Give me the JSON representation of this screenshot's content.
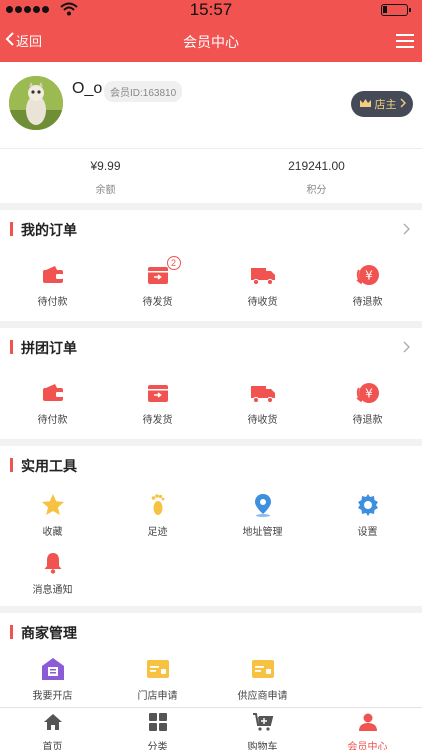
{
  "status_bar": {
    "time": "15:57"
  },
  "nav": {
    "back_label": "返回",
    "title": "会员中心"
  },
  "profile": {
    "username": "O_o",
    "member_id": "会员ID:163810",
    "shop_button": "店主"
  },
  "balance": {
    "left": {
      "value": "¥9.99",
      "label": "余额"
    },
    "right": {
      "value": "219241.00",
      "label": "积分"
    }
  },
  "my_orders": {
    "title": "我的订单",
    "items": [
      {
        "label": "待付款",
        "icon": "wallet-icon"
      },
      {
        "label": "待发货",
        "icon": "ship-box-icon",
        "badge": "2"
      },
      {
        "label": "待收货",
        "icon": "truck-icon"
      },
      {
        "label": "待退款",
        "icon": "refund-icon"
      }
    ]
  },
  "group_orders": {
    "title": "拼团订单",
    "items": [
      {
        "label": "待付款",
        "icon": "wallet-icon"
      },
      {
        "label": "待发货",
        "icon": "ship-box-icon"
      },
      {
        "label": "待收货",
        "icon": "truck-icon"
      },
      {
        "label": "待退款",
        "icon": "refund-icon"
      }
    ]
  },
  "tools": {
    "title": "实用工具",
    "items": [
      {
        "label": "收藏",
        "icon": "star-icon"
      },
      {
        "label": "足迹",
        "icon": "footprint-icon"
      },
      {
        "label": "地址管理",
        "icon": "location-icon"
      },
      {
        "label": "设置",
        "icon": "gear-icon"
      },
      {
        "label": "消息通知",
        "icon": "bell-icon"
      }
    ]
  },
  "merchant": {
    "title": "商家管理",
    "items": [
      {
        "label": "我要开店",
        "icon": "store-icon"
      },
      {
        "label": "门店申请",
        "icon": "application-card-icon"
      },
      {
        "label": "供应商申请",
        "icon": "application-card-icon"
      }
    ]
  },
  "tabbar": {
    "items": [
      {
        "label": "首页",
        "icon": "home-icon"
      },
      {
        "label": "分类",
        "icon": "category-grid-icon"
      },
      {
        "label": "购物车",
        "icon": "cart-icon"
      },
      {
        "label": "会员中心",
        "icon": "user-icon",
        "active": true
      }
    ]
  },
  "colors": {
    "brand": "#f05350",
    "tool_yellow": "#f7c241",
    "tool_blue": "#3f8fe0",
    "store_purple": "#8b5cd6",
    "tab_gray": "#555555"
  }
}
